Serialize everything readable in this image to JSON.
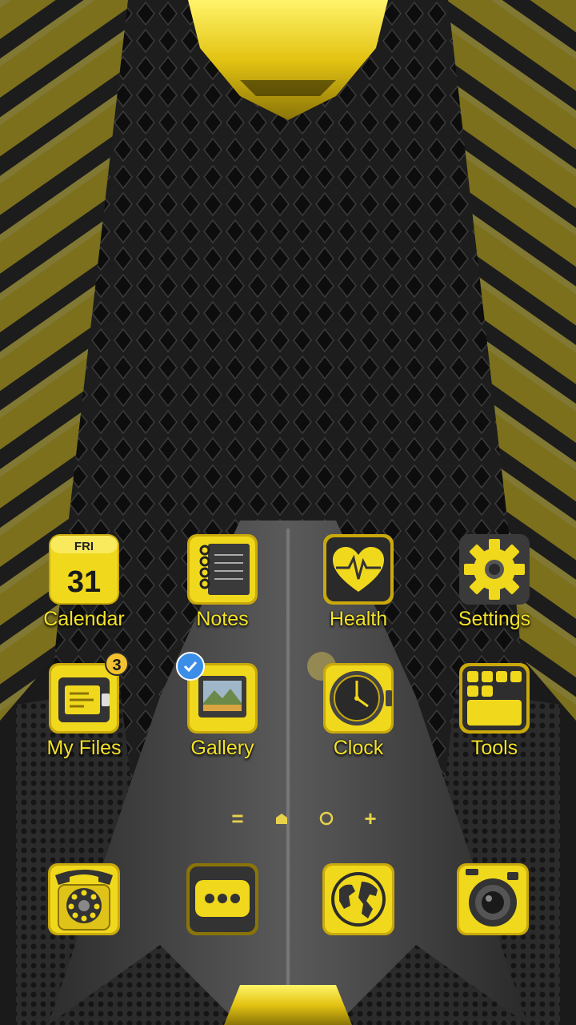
{
  "colors": {
    "accent_yellow": "#f4e32a",
    "badge": "#f2c230",
    "check_blue": "#3b8ee8",
    "dark": "#1c1c1c"
  },
  "home": {
    "row1": [
      {
        "label": "Calendar",
        "icon": "calendar-icon",
        "day_name": "FRI",
        "day_number": "31"
      },
      {
        "label": "Notes",
        "icon": "notebook-icon"
      },
      {
        "label": "Health",
        "icon": "heart-pulse-icon"
      },
      {
        "label": "Settings",
        "icon": "gear-icon"
      }
    ],
    "row2": [
      {
        "label": "My Files",
        "icon": "folder-icon",
        "badge": "3"
      },
      {
        "label": "Gallery",
        "icon": "picture-frame-icon",
        "selected": true
      },
      {
        "label": "Clock",
        "icon": "clock-icon"
      },
      {
        "label": "Tools",
        "icon": "tools-grid-icon"
      }
    ]
  },
  "page_indicator": {
    "items": [
      "=",
      "home",
      "current-page",
      "+"
    ],
    "menu_symbol": "=",
    "add_symbol": "+"
  },
  "dock": [
    {
      "icon": "rotary-phone-icon"
    },
    {
      "icon": "messages-icon"
    },
    {
      "icon": "globe-icon"
    },
    {
      "icon": "camera-icon"
    }
  ]
}
